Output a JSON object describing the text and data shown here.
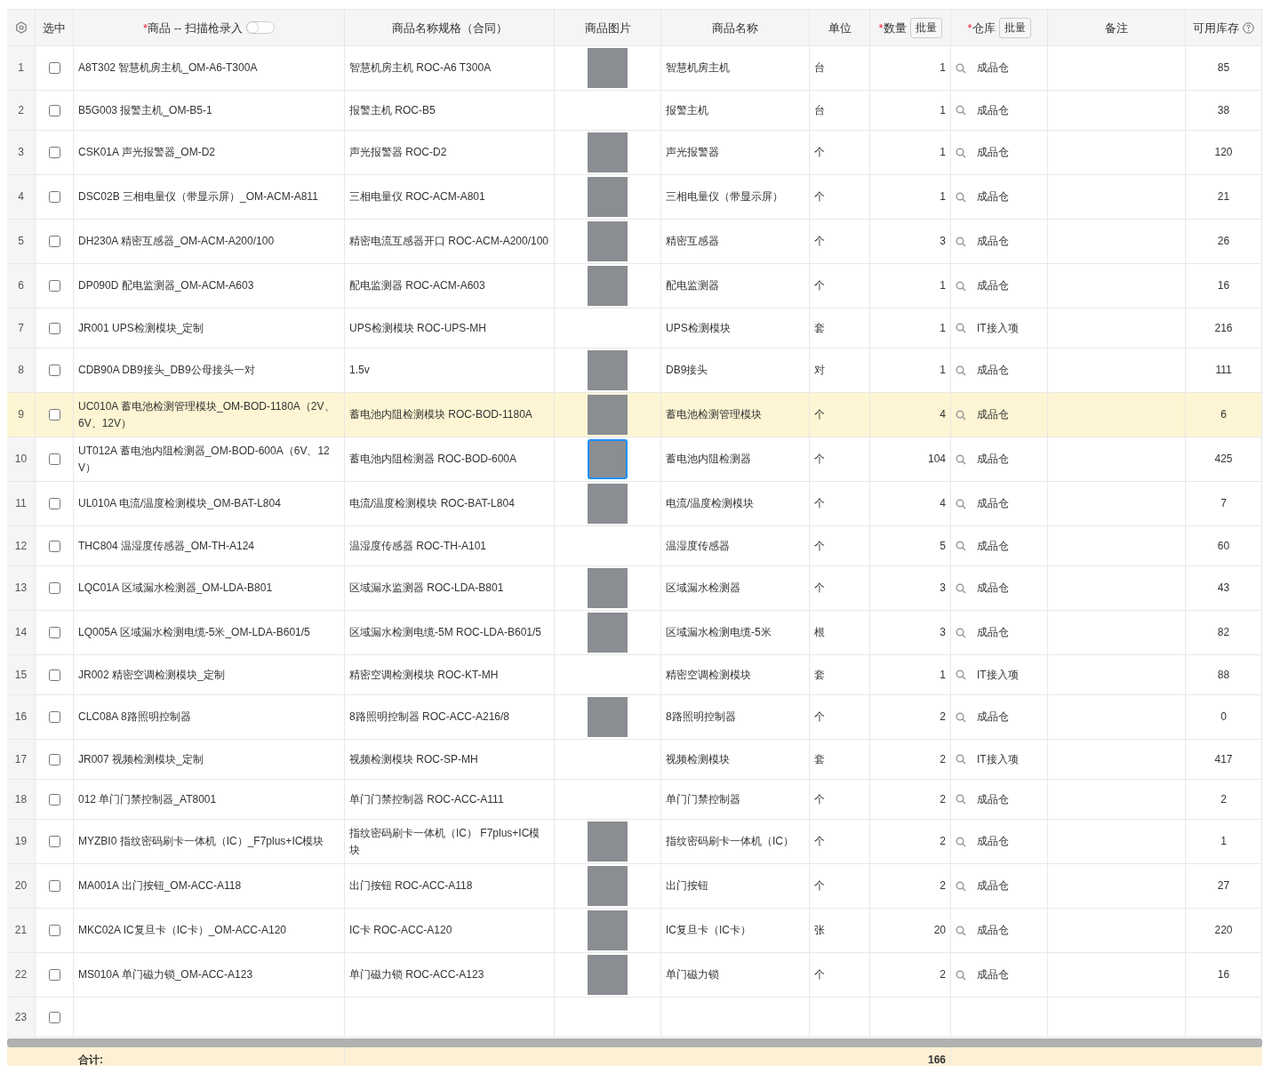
{
  "columns": [
    {
      "label": "选中"
    },
    {
      "required_mark": "*",
      "label": "商品 -- 扫描枪录入",
      "toggle": {
        "on": false
      }
    },
    {
      "label": "商品名称规格（合同）"
    },
    {
      "label": "商品图片"
    },
    {
      "label": "商品名称"
    },
    {
      "label": "单位"
    },
    {
      "required_mark": "*",
      "label": "数量",
      "batch_button": "批量"
    },
    {
      "required_mark": "*",
      "label": "仓库",
      "batch_button": "批量"
    },
    {
      "label": "备注"
    },
    {
      "label": "可用库存",
      "help": true
    }
  ],
  "rows": [
    {
      "no": "1",
      "checked": false,
      "highlighted": false,
      "product": "A8T302 智慧机房主机_OM-A6-T300A",
      "spec": "智慧机房主机 ROC-A6 T300A",
      "photo": true,
      "photo_focused": false,
      "name": "智慧机房主机",
      "unit": "台",
      "qty": "1",
      "warehouse": "成品仓",
      "stock": "85"
    },
    {
      "no": "2",
      "checked": false,
      "highlighted": false,
      "product": "B5G003 报警主机_OM-B5-1",
      "spec": "报警主机 ROC-B5",
      "photo": false,
      "name": "报警主机",
      "unit": "台",
      "qty": "1",
      "warehouse": "成品仓",
      "stock": "38"
    },
    {
      "no": "3",
      "checked": false,
      "highlighted": false,
      "product": "CSK01A 声光报警器_OM-D2",
      "spec": "声光报警器 ROC-D2",
      "photo": true,
      "photo_focused": false,
      "name": "声光报警器",
      "unit": "个",
      "qty": "1",
      "warehouse": "成品仓",
      "stock": "120"
    },
    {
      "no": "4",
      "checked": false,
      "highlighted": false,
      "product": "DSC02B 三相电量仪（带显示屏）_OM-ACM-A811",
      "spec": "三相电量仪 ROC-ACM-A801",
      "photo": true,
      "photo_focused": false,
      "name": "三相电量仪（带显示屏）",
      "unit": "个",
      "qty": "1",
      "warehouse": "成品仓",
      "stock": "21"
    },
    {
      "no": "5",
      "checked": false,
      "highlighted": false,
      "product": "DH230A 精密互感器_OM-ACM-A200/100",
      "spec": "精密电流互感器开口 ROC-ACM-A200/100",
      "photo": true,
      "photo_focused": false,
      "name": "精密互感器",
      "unit": "个",
      "qty": "3",
      "warehouse": "成品仓",
      "stock": "26"
    },
    {
      "no": "6",
      "checked": false,
      "highlighted": false,
      "product": "DP090D 配电监测器_OM-ACM-A603",
      "spec": "配电监测器 ROC-ACM-A603",
      "photo": true,
      "photo_focused": false,
      "name": "配电监测器",
      "unit": "个",
      "qty": "1",
      "warehouse": "成品仓",
      "stock": "16"
    },
    {
      "no": "7",
      "checked": false,
      "highlighted": false,
      "product": "JR001 UPS检测模块_定制",
      "spec": "UPS检测模块 ROC-UPS-MH",
      "photo": false,
      "name": "UPS检测模块",
      "unit": "套",
      "qty": "1",
      "warehouse": "IT接入项",
      "stock": "216"
    },
    {
      "no": "8",
      "checked": false,
      "highlighted": false,
      "product": "CDB90A DB9接头_DB9公母接头一对",
      "spec": "1.5v",
      "photo": true,
      "photo_focused": false,
      "name": "DB9接头",
      "unit": "对",
      "qty": "1",
      "warehouse": "成品仓",
      "stock": "111"
    },
    {
      "no": "9",
      "checked": false,
      "highlighted": true,
      "product": "UC010A 蓄电池检测管理模块_OM-BOD-1180A（2V、6V、12V）",
      "spec": "蓄电池内阻检测模块 ROC-BOD-1180A",
      "photo": true,
      "photo_focused": false,
      "name": "蓄电池检测管理模块",
      "unit": "个",
      "qty": "4",
      "warehouse": "成品仓",
      "stock": "6"
    },
    {
      "no": "10",
      "checked": false,
      "highlighted": false,
      "product": "UT012A 蓄电池内阻检测器_OM-BOD-600A（6V、12V）",
      "spec": "蓄电池内阻检测器 ROC-BOD-600A",
      "photo": true,
      "photo_focused": true,
      "name": "蓄电池内阻检测器",
      "unit": "个",
      "qty": "104",
      "warehouse": "成品仓",
      "stock": "425"
    },
    {
      "no": "11",
      "checked": false,
      "highlighted": false,
      "product": "UL010A 电流/温度检测模块_OM-BAT-L804",
      "spec": "电流/温度检测模块 ROC-BAT-L804",
      "photo": true,
      "photo_focused": false,
      "name": "电流/温度检测模块",
      "unit": "个",
      "qty": "4",
      "warehouse": "成品仓",
      "stock": "7"
    },
    {
      "no": "12",
      "checked": false,
      "highlighted": false,
      "product": "THC804 温湿度传感器_OM-TH-A124",
      "spec": "温湿度传感器 ROC-TH-A101",
      "photo": false,
      "name": "温湿度传感器",
      "unit": "个",
      "qty": "5",
      "warehouse": "成品仓",
      "stock": "60"
    },
    {
      "no": "13",
      "checked": false,
      "highlighted": false,
      "product": "LQC01A 区域漏水检测器_OM-LDA-B801",
      "spec": "区域漏水监测器 ROC-LDA-B801",
      "photo": true,
      "photo_focused": false,
      "name": "区域漏水检测器",
      "unit": "个",
      "qty": "3",
      "warehouse": "成品仓",
      "stock": "43"
    },
    {
      "no": "14",
      "checked": false,
      "highlighted": false,
      "product": "LQ005A 区域漏水检测电缆-5米_OM-LDA-B601/5",
      "spec": "区域漏水检测电缆-5M ROC-LDA-B601/5",
      "photo": true,
      "photo_focused": false,
      "name": "区域漏水检测电缆-5米",
      "unit": "根",
      "qty": "3",
      "warehouse": "成品仓",
      "stock": "82"
    },
    {
      "no": "15",
      "checked": false,
      "highlighted": false,
      "product": "JR002 精密空调检测模块_定制",
      "spec": "精密空调检测模块 ROC-KT-MH",
      "photo": false,
      "name": "精密空调检测模块",
      "unit": "套",
      "qty": "1",
      "warehouse": "IT接入项",
      "stock": "88"
    },
    {
      "no": "16",
      "checked": false,
      "highlighted": false,
      "product": "CLC08A 8路照明控制器",
      "spec": "8路照明控制器 ROC-ACC-A216/8",
      "photo": true,
      "photo_focused": false,
      "name": "8路照明控制器",
      "unit": "个",
      "qty": "2",
      "warehouse": "成品仓",
      "stock": "0"
    },
    {
      "no": "17",
      "checked": false,
      "highlighted": false,
      "product": "JR007 视频检测模块_定制",
      "spec": "视频检测模块 ROC-SP-MH",
      "photo": false,
      "name": "视频检测模块",
      "unit": "套",
      "qty": "2",
      "warehouse": "IT接入项",
      "stock": "417"
    },
    {
      "no": "18",
      "checked": false,
      "highlighted": false,
      "product": "012 单门门禁控制器_AT8001",
      "spec": "单门门禁控制器 ROC-ACC-A111",
      "photo": false,
      "name": "单门门禁控制器",
      "unit": "个",
      "qty": "2",
      "warehouse": "成品仓",
      "stock": "2"
    },
    {
      "no": "19",
      "checked": false,
      "highlighted": false,
      "product": "MYZBI0 指纹密码刷卡一体机（IC）_F7plus+IC模块",
      "spec": "指纹密码刷卡一体机（IC） F7plus+IC模块",
      "photo": true,
      "photo_focused": false,
      "name": "指纹密码刷卡一体机（IC）",
      "unit": "个",
      "qty": "2",
      "warehouse": "成品仓",
      "stock": "1"
    },
    {
      "no": "20",
      "checked": false,
      "highlighted": false,
      "product": "MA001A 出门按钮_OM-ACC-A118",
      "spec": "出门按钮 ROC-ACC-A118",
      "photo": true,
      "photo_focused": false,
      "name": "出门按钮",
      "unit": "个",
      "qty": "2",
      "warehouse": "成品仓",
      "stock": "27"
    },
    {
      "no": "21",
      "checked": false,
      "highlighted": false,
      "product": "MKC02A IC复旦卡（IC卡）_OM-ACC-A120",
      "spec": "IC卡 ROC-ACC-A120",
      "photo": true,
      "photo_focused": false,
      "name": "IC复旦卡（IC卡）",
      "unit": "张",
      "qty": "20",
      "warehouse": "成品仓",
      "stock": "220"
    },
    {
      "no": "22",
      "checked": false,
      "highlighted": false,
      "product": "MS010A 单门磁力锁_OM-ACC-A123",
      "spec": "单门磁力锁 ROC-ACC-A123",
      "photo": true,
      "photo_focused": false,
      "name": "单门磁力锁",
      "unit": "个",
      "qty": "2",
      "warehouse": "成品仓",
      "stock": "16"
    },
    {
      "no": "23",
      "checked": false,
      "highlighted": false,
      "photo": false
    }
  ],
  "footer": {
    "label": "合计:",
    "qty_total": "166"
  }
}
